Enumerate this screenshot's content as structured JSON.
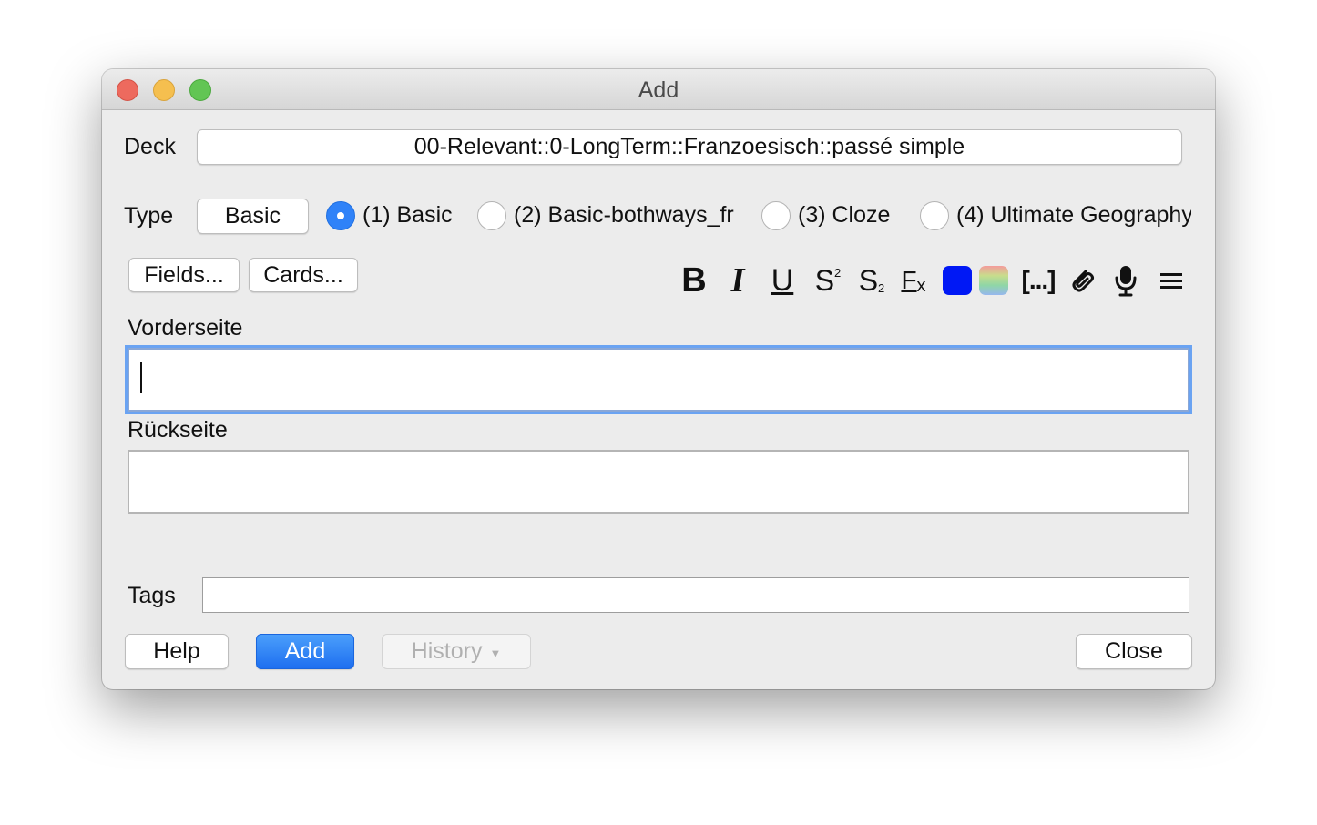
{
  "window": {
    "title": "Add"
  },
  "deck": {
    "label": "Deck",
    "value": "00-Relevant::0-LongTerm::Franzoesisch::passé simple"
  },
  "type": {
    "label": "Type",
    "button": "Basic",
    "options": [
      {
        "label": "(1) Basic",
        "selected": true
      },
      {
        "label": "(2) Basic-bothways_fr",
        "selected": false
      },
      {
        "label": "(3) Cloze",
        "selected": false
      },
      {
        "label": "(4) Ultimate Geography",
        "selected": false
      }
    ]
  },
  "toolbar": {
    "fields_label": "Fields...",
    "cards_label": "Cards...",
    "format": {
      "bold": "B",
      "italic": "I",
      "underline": "U",
      "superscript": "S",
      "superscript_mark": "2",
      "subscript": "S",
      "subscript_mark": "2",
      "clear": "F",
      "clear_mark": "x",
      "cloze": "[...]",
      "text_color": "#0018f5",
      "icons": [
        "bold-icon",
        "italic-icon",
        "underline-icon",
        "superscript-icon",
        "subscript-icon",
        "clear-format-icon",
        "text-color-icon",
        "highlight-color-icon",
        "cloze-icon",
        "attachment-icon",
        "microphone-icon",
        "menu-icon"
      ]
    }
  },
  "fields": [
    {
      "name": "Vorderseite",
      "value": ""
    },
    {
      "name": "Rückseite",
      "value": ""
    }
  ],
  "tags": {
    "label": "Tags",
    "value": ""
  },
  "buttons": {
    "help": "Help",
    "add": "Add",
    "history": "History",
    "close": "Close"
  },
  "colors": {
    "accent": "#2f82f8",
    "focus": "#6aa3f2"
  }
}
